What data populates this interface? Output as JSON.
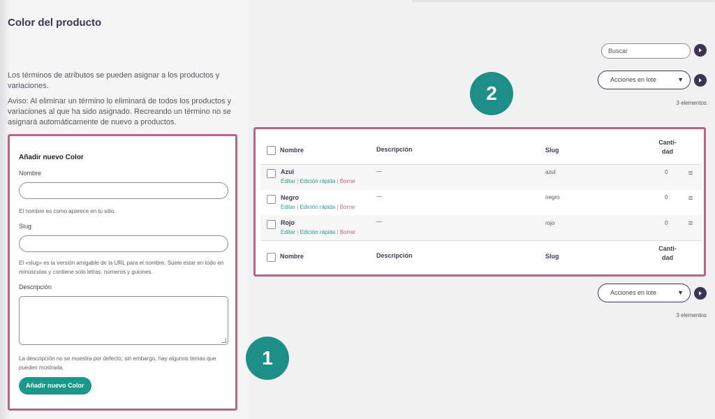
{
  "page": {
    "title": "Color del producto",
    "intro": "Los términos de atributos se pueden asignar a los productos y variaciones.",
    "notice": "Aviso: Al eliminar un término lo eliminará de todos los productos y variaciones al que ha sido asignado. Recreando un término no se asignará automáticamente de nuevo a productos."
  },
  "form": {
    "heading": "Añadir nuevo Color",
    "name_label": "Nombre",
    "name_value": "",
    "name_help": "El nombre es como aparece en tu sitio.",
    "slug_label": "Slug",
    "slug_value": "",
    "slug_help": "El «slug» es la versión amigable de la URL para el nombre. Suele estar en todo en minúsculas y contiene solo letras, números y guiones.",
    "desc_label": "Descripción",
    "desc_value": "",
    "desc_help": "La descripción no se muestra por defecto; sin embargo, hay algunos temas que pueden mostrarla.",
    "submit_label": "Añadir nuevo Color"
  },
  "badges": {
    "form_number": "1",
    "table_number": "2"
  },
  "toolbar": {
    "search_placeholder": "Buscar",
    "bulk_label": "Acciones en lote",
    "bulk_caret": "▼",
    "count_label": "3 elementos"
  },
  "table": {
    "headers": {
      "name": "Nombre",
      "description": "Descripción",
      "slug": "Slug",
      "qty_line1": "Canti-",
      "qty_line2": "dad"
    },
    "row_actions": {
      "edit": "Editar",
      "quick_edit": "Edición rápida",
      "delete": "Borrar",
      "sep": "|"
    },
    "rows": [
      {
        "name": "Azul",
        "description": "—",
        "slug": "azul",
        "count": "0"
      },
      {
        "name": "Negro",
        "description": "—",
        "slug": "negro",
        "count": "0"
      },
      {
        "name": "Rojo",
        "description": "—",
        "slug": "rojo",
        "count": "0"
      }
    ]
  },
  "colors": {
    "accent_teal": "#1a9889",
    "highlight_border": "#b5678a",
    "dark_button": "#3d3455"
  },
  "icons": {
    "submit_icon": "play-arrow-icon",
    "drag": "drag-handle-icon",
    "dropdown": "chevron-down-icon"
  }
}
